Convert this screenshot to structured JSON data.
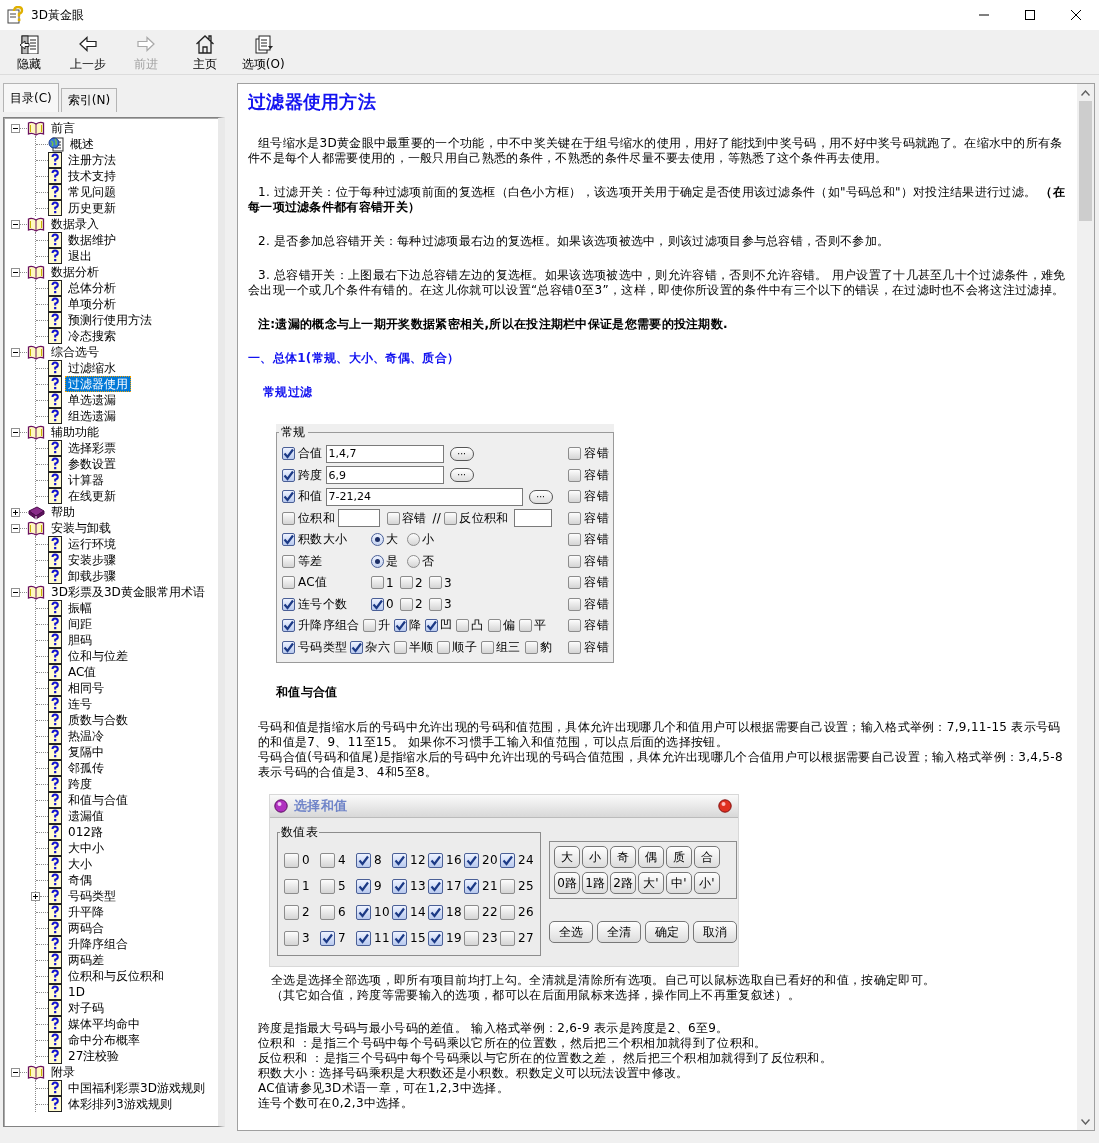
{
  "window": {
    "title": "3D黃金眼"
  },
  "toolbar": [
    {
      "label": "隐藏",
      "kind": "hide",
      "disabled": false
    },
    {
      "label": "上一步",
      "kind": "back",
      "disabled": false
    },
    {
      "label": "前进",
      "kind": "forward",
      "disabled": true
    },
    {
      "label": "主页",
      "kind": "home",
      "disabled": false
    },
    {
      "label": "选项(O)",
      "kind": "options",
      "disabled": false
    }
  ],
  "tabs": [
    {
      "label": "目录(C)",
      "selected": true
    },
    {
      "label": "索引(N)",
      "selected": false
    }
  ],
  "tree": [
    {
      "label": "前言",
      "kind": "book",
      "expanded": true,
      "selected": false,
      "children": [
        {
          "label": "概述",
          "kind": "web-topic",
          "selected": false
        },
        {
          "label": "注册方法",
          "kind": "topic",
          "selected": false
        },
        {
          "label": "技术支持",
          "kind": "topic",
          "selected": false
        },
        {
          "label": "常见问题",
          "kind": "topic",
          "selected": false
        },
        {
          "label": "历史更新",
          "kind": "topic",
          "selected": false
        }
      ]
    },
    {
      "label": "数据录入",
      "kind": "book",
      "expanded": true,
      "selected": false,
      "children": [
        {
          "label": "数据维护",
          "kind": "topic",
          "selected": false
        },
        {
          "label": "退出",
          "kind": "topic",
          "selected": false
        }
      ]
    },
    {
      "label": "数据分析",
      "kind": "book",
      "expanded": true,
      "selected": false,
      "children": [
        {
          "label": "总体分析",
          "kind": "topic",
          "selected": false
        },
        {
          "label": "单项分析",
          "kind": "topic",
          "selected": false
        },
        {
          "label": "预测行使用方法",
          "kind": "topic",
          "selected": false
        },
        {
          "label": "冷态搜索",
          "kind": "topic",
          "selected": false
        }
      ]
    },
    {
      "label": "综合选号",
      "kind": "book",
      "expanded": true,
      "selected": false,
      "children": [
        {
          "label": "过滤缩水",
          "kind": "topic",
          "selected": false
        },
        {
          "label": "过滤器使用",
          "kind": "topic",
          "selected": true
        },
        {
          "label": "单选遗漏",
          "kind": "topic",
          "selected": false
        },
        {
          "label": "组选遗漏",
          "kind": "topic",
          "selected": false
        }
      ]
    },
    {
      "label": "辅助功能",
      "kind": "book",
      "expanded": true,
      "selected": false,
      "children": [
        {
          "label": "选择彩票",
          "kind": "topic",
          "selected": false
        },
        {
          "label": "参数设置",
          "kind": "topic",
          "selected": false
        },
        {
          "label": "计算器",
          "kind": "topic",
          "selected": false
        },
        {
          "label": "在线更新",
          "kind": "topic",
          "selected": false
        }
      ]
    },
    {
      "label": "帮助",
      "kind": "book",
      "expanded": false,
      "selected": false
    },
    {
      "label": "安装与卸载",
      "kind": "book",
      "expanded": true,
      "selected": false,
      "children": [
        {
          "label": "运行环境",
          "kind": "topic",
          "selected": false
        },
        {
          "label": "安装步骤",
          "kind": "topic",
          "selected": false
        },
        {
          "label": "卸载步骤",
          "kind": "topic",
          "selected": false
        }
      ]
    },
    {
      "label": "3D彩票及3D黄金眼常用术语",
      "kind": "book",
      "expanded": true,
      "selected": false,
      "children": [
        {
          "label": "振幅",
          "kind": "topic",
          "selected": false
        },
        {
          "label": "间距",
          "kind": "topic",
          "selected": false
        },
        {
          "label": "胆码",
          "kind": "topic",
          "selected": false
        },
        {
          "label": "位和与位差",
          "kind": "topic",
          "selected": false
        },
        {
          "label": "AC值",
          "kind": "topic",
          "selected": false
        },
        {
          "label": "相同号",
          "kind": "topic",
          "selected": false
        },
        {
          "label": "连号",
          "kind": "topic",
          "selected": false
        },
        {
          "label": "质数与合数",
          "kind": "topic",
          "selected": false
        },
        {
          "label": "热温冷",
          "kind": "topic",
          "selected": false
        },
        {
          "label": "复隔中",
          "kind": "topic",
          "selected": false
        },
        {
          "label": "邻孤传",
          "kind": "topic",
          "selected": false
        },
        {
          "label": "跨度",
          "kind": "topic",
          "selected": false
        },
        {
          "label": "和值与合值",
          "kind": "topic",
          "selected": false
        },
        {
          "label": "遗漏值",
          "kind": "topic",
          "selected": false
        },
        {
          "label": "012路",
          "kind": "topic",
          "selected": false
        },
        {
          "label": "大中小",
          "kind": "topic",
          "selected": false
        },
        {
          "label": "大小",
          "kind": "topic",
          "selected": false
        },
        {
          "label": "奇偶",
          "kind": "topic",
          "selected": false
        },
        {
          "label": "号码类型",
          "kind": "topic",
          "expanded": false,
          "selected": false
        },
        {
          "label": "升平降",
          "kind": "topic",
          "selected": false
        },
        {
          "label": "两码合",
          "kind": "topic",
          "selected": false
        },
        {
          "label": "升降序组合",
          "kind": "topic",
          "selected": false
        },
        {
          "label": "两码差",
          "kind": "topic",
          "selected": false
        },
        {
          "label": "位积和与反位积和",
          "kind": "topic",
          "selected": false
        },
        {
          "label": "1D",
          "kind": "topic",
          "selected": false
        },
        {
          "label": "对子码",
          "kind": "topic",
          "selected": false
        },
        {
          "label": "媒体平均命中",
          "kind": "topic",
          "selected": false
        },
        {
          "label": "命中分布概率",
          "kind": "topic",
          "selected": false
        },
        {
          "label": "27注校验",
          "kind": "topic",
          "selected": false
        }
      ]
    },
    {
      "label": "附录",
      "kind": "book",
      "expanded": true,
      "selected": false,
      "children": [
        {
          "label": "中国福利彩票3D游戏规则",
          "kind": "topic",
          "selected": false
        },
        {
          "label": "体彩排列3游戏规则",
          "kind": "topic",
          "selected": false
        }
      ]
    }
  ],
  "content": {
    "title": "过滤器使用方法",
    "blocks": [
      {
        "kind": "para",
        "text": "组号缩水是3D黄金眼中最重要的一个功能，中不中奖关键在于组号缩水的使用，用好了能找到中奖号码，用不好中奖号码就跑了。在缩水中的所有条件不是每个人都需要使用的，一般只用自己熟悉的条件，不熟悉的条件尽量不要去使用，等熟悉了这个条件再去使用。"
      },
      {
        "kind": "para",
        "text": "1. 过滤开关：位于每种过滤项前面的复选框（白色小方框），该选项开关用于确定是否使用该过滤条件（如\"号码总和\"）对投注结果进行过滤。 **（在每一项过滤条件都有容错开关）**"
      },
      {
        "kind": "para",
        "text": "2. 是否参加总容错开关：每种过滤项最右边的复选框。如果该选项被选中，则该过滤项目参与总容错，否则不参加。"
      },
      {
        "kind": "para",
        "text": "3. 总容错开关：上图最右下边总容错左边的复选框。如果该选项被选中，则允许容错，否则不允许容错。 用户设置了十几甚至几十个过滤条件，难免会出现一个或几个条件有错的。在这儿你就可以设置“总容错0至3”，这样，即使你所设置的条件中有三个以下的错误，在过滤时也不会将这注过滤掉。"
      },
      {
        "kind": "note",
        "text": "注:遗漏的概念与上一期开奖数据紧密相关,所以在投注期栏中保证是您需要的投注期数."
      },
      {
        "kind": "heading",
        "text": "一、总体1(常规、大小、奇偶、质合）"
      },
      {
        "kind": "subheading",
        "text": "常规过滤"
      },
      {
        "kind": "filter-panel",
        "legend": "常规",
        "rows": [
          {
            "kind": "input",
            "label": "合值",
            "checked": true,
            "value": "1,4,7",
            "picker": "···",
            "tolerance": {
              "label": "容错",
              "checked": false
            }
          },
          {
            "kind": "input",
            "label": "跨度",
            "checked": true,
            "value": "6,9",
            "picker": "···",
            "tolerance": {
              "label": "容错",
              "checked": false
            }
          },
          {
            "kind": "input",
            "label": "和值",
            "checked": true,
            "value": "7-21,24",
            "picker": "···",
            "tolerance": {
              "label": "容错",
              "checked": false
            }
          },
          {
            "kind": "dual",
            "label": "位积和",
            "checked": false,
            "inner_tolerance": {
              "label": "容错",
              "checked": false
            },
            "separator": "//",
            "second": {
              "label": "反位积和",
              "checked": false
            },
            "tolerance": {
              "label": "容错",
              "checked": false
            }
          },
          {
            "kind": "radio",
            "label": "积数大小",
            "checked": true,
            "options": [
              {
                "label": "大",
                "selected": true
              },
              {
                "label": "小",
                "selected": false
              }
            ],
            "tolerance": {
              "label": "容错",
              "checked": false
            }
          },
          {
            "kind": "radio",
            "label": "等差",
            "checked": false,
            "options": [
              {
                "label": "是",
                "selected": true
              },
              {
                "label": "否",
                "selected": false
              }
            ],
            "tolerance": {
              "label": "容错",
              "checked": false
            }
          },
          {
            "kind": "checks",
            "label": "AC值",
            "checked": false,
            "options": [
              {
                "label": "1",
                "checked": false
              },
              {
                "label": "2",
                "checked": false
              },
              {
                "label": "3",
                "checked": false
              }
            ],
            "tolerance": {
              "label": "容错",
              "checked": false
            }
          },
          {
            "kind": "checks",
            "label": "连号个数",
            "checked": true,
            "options": [
              {
                "label": "0",
                "checked": true
              },
              {
                "label": "2",
                "checked": false
              },
              {
                "label": "3",
                "checked": false
              }
            ],
            "tolerance": {
              "label": "容错",
              "checked": false
            }
          },
          {
            "kind": "checks",
            "label": "升降序组合",
            "checked": true,
            "options": [
              {
                "label": "升",
                "checked": false
              },
              {
                "label": "降",
                "checked": true
              },
              {
                "label": "凹",
                "checked": true
              },
              {
                "label": "凸",
                "checked": false
              },
              {
                "label": "偏",
                "checked": false
              },
              {
                "label": "平",
                "checked": false
              }
            ],
            "tolerance": {
              "label": "容错",
              "checked": false
            }
          },
          {
            "kind": "checks",
            "label": "号码类型",
            "checked": true,
            "options": [
              {
                "label": "杂六",
                "checked": true
              },
              {
                "label": "半顺",
                "checked": false
              },
              {
                "label": "顺子",
                "checked": false
              },
              {
                "label": "组三",
                "checked": false
              },
              {
                "label": "豹",
                "checked": false
              }
            ],
            "tolerance": {
              "label": "容错",
              "checked": false
            }
          }
        ]
      },
      {
        "kind": "section",
        "text": "和值与合值"
      },
      {
        "kind": "line",
        "text": "号码和值是指缩水后的号码中允许出现的号码和值范围，具体允许出现哪几个和值用户可以根据需要自己设置；输入格式举例：7,9,11-15 表示号码的和值是7、9、11至15。 如果你不习惯手工输入和值范围，可以点后面的选择按钮。"
      },
      {
        "kind": "line",
        "text": "号码合值(号码和值尾)是指缩水后的号码中允许出现的号码合值范围，具体允许出现哪几个合值用户可以根据需要自己设置；输入格式举例：3,4,5-8 表示号码的合值是3、4和5至8。"
      },
      {
        "kind": "dialog",
        "title": "选择和值",
        "group": "数值表",
        "values": [
          {
            "label": "0",
            "checked": false
          },
          {
            "label": "1",
            "checked": false
          },
          {
            "label": "2",
            "checked": false
          },
          {
            "label": "3",
            "checked": false
          },
          {
            "label": "4",
            "checked": false
          },
          {
            "label": "5",
            "checked": false
          },
          {
            "label": "6",
            "checked": false
          },
          {
            "label": "7",
            "checked": true
          },
          {
            "label": "8",
            "checked": true
          },
          {
            "label": "9",
            "checked": true
          },
          {
            "label": "10",
            "checked": true
          },
          {
            "label": "11",
            "checked": true
          },
          {
            "label": "12",
            "checked": true
          },
          {
            "label": "13",
            "checked": true
          },
          {
            "label": "14",
            "checked": true
          },
          {
            "label": "15",
            "checked": true
          },
          {
            "label": "16",
            "checked": true
          },
          {
            "label": "17",
            "checked": true
          },
          {
            "label": "18",
            "checked": true
          },
          {
            "label": "19",
            "checked": true
          },
          {
            "label": "20",
            "checked": true
          },
          {
            "label": "21",
            "checked": true
          },
          {
            "label": "22",
            "checked": false
          },
          {
            "label": "23",
            "checked": false
          },
          {
            "label": "24",
            "checked": true
          },
          {
            "label": "25",
            "checked": false
          },
          {
            "label": "26",
            "checked": false
          },
          {
            "label": "27",
            "checked": false
          }
        ],
        "quick_buttons": [
          "大",
          "小",
          "奇",
          "偶",
          "质",
          "合",
          "0路",
          "1路",
          "2路",
          "大'",
          "中'",
          "小'"
        ],
        "actions": [
          "全选",
          "全清",
          "确定",
          "取消"
        ]
      },
      {
        "kind": "caption",
        "text": "全选是选择全部选项，即所有项目前均打上勾。全清就是清除所有选项。自己可以鼠标选取自已看好的和值，按确定即可。"
      },
      {
        "kind": "caption",
        "text": "（其它如合值，跨度等需要输入的选项，都可以在后面用鼠标来选择，操作同上不再重复叙述）。"
      },
      {
        "kind": "gap-line",
        "text": "跨度是指最大号码与最小号码的差值。 输入格式举例：2,6-9 表示是跨度是2、6至9。"
      },
      {
        "kind": "line",
        "text": "位积和 ：是指三个号码中每个号码乘以它所在的位置数，然后把三个积相加就得到了位积和。"
      },
      {
        "kind": "line",
        "text": "反位积和 ：是指三个号码中每个号码乘以与它所在的位置数之差， 然后把三个积相加就得到了反位积和。"
      },
      {
        "kind": "line",
        "text": "积数大小：选择号码乘积是大积数还是小积数。积数定义可以玩法设置中修改。"
      },
      {
        "kind": "line",
        "text": "AC值请参见3D术语一章，可在1,2,3中选择。"
      },
      {
        "kind": "line",
        "text": "连号个数可在0,2,3中选择。"
      }
    ]
  }
}
